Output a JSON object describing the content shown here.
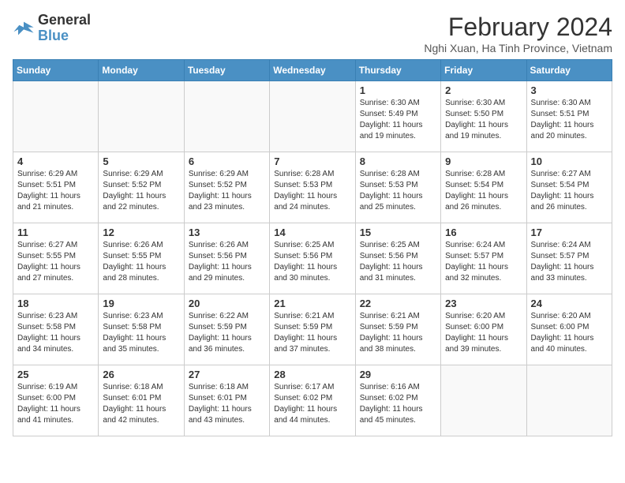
{
  "header": {
    "logo_line1": "General",
    "logo_line2": "Blue",
    "title": "February 2024",
    "subtitle": "Nghi Xuan, Ha Tinh Province, Vietnam"
  },
  "days_of_week": [
    "Sunday",
    "Monday",
    "Tuesday",
    "Wednesday",
    "Thursday",
    "Friday",
    "Saturday"
  ],
  "weeks": [
    [
      {
        "day": "",
        "info": ""
      },
      {
        "day": "",
        "info": ""
      },
      {
        "day": "",
        "info": ""
      },
      {
        "day": "",
        "info": ""
      },
      {
        "day": "1",
        "info": "Sunrise: 6:30 AM\nSunset: 5:49 PM\nDaylight: 11 hours and 19 minutes."
      },
      {
        "day": "2",
        "info": "Sunrise: 6:30 AM\nSunset: 5:50 PM\nDaylight: 11 hours and 19 minutes."
      },
      {
        "day": "3",
        "info": "Sunrise: 6:30 AM\nSunset: 5:51 PM\nDaylight: 11 hours and 20 minutes."
      }
    ],
    [
      {
        "day": "4",
        "info": "Sunrise: 6:29 AM\nSunset: 5:51 PM\nDaylight: 11 hours and 21 minutes."
      },
      {
        "day": "5",
        "info": "Sunrise: 6:29 AM\nSunset: 5:52 PM\nDaylight: 11 hours and 22 minutes."
      },
      {
        "day": "6",
        "info": "Sunrise: 6:29 AM\nSunset: 5:52 PM\nDaylight: 11 hours and 23 minutes."
      },
      {
        "day": "7",
        "info": "Sunrise: 6:28 AM\nSunset: 5:53 PM\nDaylight: 11 hours and 24 minutes."
      },
      {
        "day": "8",
        "info": "Sunrise: 6:28 AM\nSunset: 5:53 PM\nDaylight: 11 hours and 25 minutes."
      },
      {
        "day": "9",
        "info": "Sunrise: 6:28 AM\nSunset: 5:54 PM\nDaylight: 11 hours and 26 minutes."
      },
      {
        "day": "10",
        "info": "Sunrise: 6:27 AM\nSunset: 5:54 PM\nDaylight: 11 hours and 26 minutes."
      }
    ],
    [
      {
        "day": "11",
        "info": "Sunrise: 6:27 AM\nSunset: 5:55 PM\nDaylight: 11 hours and 27 minutes."
      },
      {
        "day": "12",
        "info": "Sunrise: 6:26 AM\nSunset: 5:55 PM\nDaylight: 11 hours and 28 minutes."
      },
      {
        "day": "13",
        "info": "Sunrise: 6:26 AM\nSunset: 5:56 PM\nDaylight: 11 hours and 29 minutes."
      },
      {
        "day": "14",
        "info": "Sunrise: 6:25 AM\nSunset: 5:56 PM\nDaylight: 11 hours and 30 minutes."
      },
      {
        "day": "15",
        "info": "Sunrise: 6:25 AM\nSunset: 5:56 PM\nDaylight: 11 hours and 31 minutes."
      },
      {
        "day": "16",
        "info": "Sunrise: 6:24 AM\nSunset: 5:57 PM\nDaylight: 11 hours and 32 minutes."
      },
      {
        "day": "17",
        "info": "Sunrise: 6:24 AM\nSunset: 5:57 PM\nDaylight: 11 hours and 33 minutes."
      }
    ],
    [
      {
        "day": "18",
        "info": "Sunrise: 6:23 AM\nSunset: 5:58 PM\nDaylight: 11 hours and 34 minutes."
      },
      {
        "day": "19",
        "info": "Sunrise: 6:23 AM\nSunset: 5:58 PM\nDaylight: 11 hours and 35 minutes."
      },
      {
        "day": "20",
        "info": "Sunrise: 6:22 AM\nSunset: 5:59 PM\nDaylight: 11 hours and 36 minutes."
      },
      {
        "day": "21",
        "info": "Sunrise: 6:21 AM\nSunset: 5:59 PM\nDaylight: 11 hours and 37 minutes."
      },
      {
        "day": "22",
        "info": "Sunrise: 6:21 AM\nSunset: 5:59 PM\nDaylight: 11 hours and 38 minutes."
      },
      {
        "day": "23",
        "info": "Sunrise: 6:20 AM\nSunset: 6:00 PM\nDaylight: 11 hours and 39 minutes."
      },
      {
        "day": "24",
        "info": "Sunrise: 6:20 AM\nSunset: 6:00 PM\nDaylight: 11 hours and 40 minutes."
      }
    ],
    [
      {
        "day": "25",
        "info": "Sunrise: 6:19 AM\nSunset: 6:00 PM\nDaylight: 11 hours and 41 minutes."
      },
      {
        "day": "26",
        "info": "Sunrise: 6:18 AM\nSunset: 6:01 PM\nDaylight: 11 hours and 42 minutes."
      },
      {
        "day": "27",
        "info": "Sunrise: 6:18 AM\nSunset: 6:01 PM\nDaylight: 11 hours and 43 minutes."
      },
      {
        "day": "28",
        "info": "Sunrise: 6:17 AM\nSunset: 6:02 PM\nDaylight: 11 hours and 44 minutes."
      },
      {
        "day": "29",
        "info": "Sunrise: 6:16 AM\nSunset: 6:02 PM\nDaylight: 11 hours and 45 minutes."
      },
      {
        "day": "",
        "info": ""
      },
      {
        "day": "",
        "info": ""
      }
    ]
  ]
}
